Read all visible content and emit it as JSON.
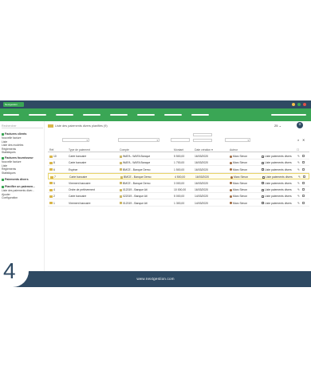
{
  "titlebar": {
    "tag": "Nextgestion"
  },
  "colors": {
    "brand_green": "#3aa655",
    "brand_navy": "#2f4a63",
    "highlight": "#e9d56a"
  },
  "sidebar": {
    "search_placeholder": "Rechercher",
    "sections": [
      {
        "title": "Factures clients",
        "items": [
          "Nouvelle facture",
          "Liste",
          "Liste des modèles",
          "Règlements",
          "Statistiques"
        ]
      },
      {
        "title": "Factures fournisseur",
        "items": [
          "Nouvelle facture",
          "Liste",
          "Règlements",
          "Statistiques"
        ]
      },
      {
        "title": "Paiements divers",
        "items": []
      },
      {
        "title": "Planifier un paiemen...",
        "items": [
          "Liste des paiements diver...",
          "Ajouter",
          "Configuration"
        ]
      }
    ]
  },
  "main": {
    "title": "Liste des paiements divers planifiés",
    "title_count": "(9)",
    "per_page": "25",
    "columns": [
      "Réf.",
      "Type de paiement",
      "Compte",
      "Montant",
      "Date création",
      "Auteur"
    ],
    "rows": [
      {
        "ref": "10",
        "type": "Carte bancaire",
        "account": "WAFA - WAFA Banque",
        "amount": "5 500,00",
        "date": "16/03/2020",
        "author": "Marc Simon",
        "list": "Liste paiements divers",
        "selected": false
      },
      {
        "ref": "8",
        "type": "Carte bancaire",
        "account": "WAFA - WAFA Banque",
        "amount": "1 700,00",
        "date": "16/03/2020",
        "author": "Marc Simon",
        "list": "Liste paiements divers",
        "selected": false
      },
      {
        "ref": "6",
        "type": "Espèce",
        "account": "BMCE - Banque Demo",
        "amount": "1 500,00",
        "date": "16/03/2020",
        "author": "Marc Simon",
        "list": "Liste paiements divers",
        "selected": false
      },
      {
        "ref": "7",
        "type": "Carte bancaire",
        "account": "BMCE - Banque Demo",
        "amount": "4 500,00",
        "date": "16/03/2020",
        "author": "Marc Simon",
        "list": "Liste paiements divers",
        "selected": true
      },
      {
        "ref": "5",
        "type": "Virement bancaire",
        "account": "BMCE - Banque Demo",
        "amount": "3 000,00",
        "date": "16/03/2020",
        "author": "Marc Simon",
        "list": "Liste paiements divers",
        "selected": false
      },
      {
        "ref": "4",
        "type": "Ordre de prélèvement",
        "account": "012019 - Banque Ati",
        "amount": "10 000,00",
        "date": "16/03/2020",
        "author": "Marc Simon",
        "list": "Liste paiements divers",
        "selected": false
      },
      {
        "ref": "2",
        "type": "Carte bancaire",
        "account": "022019 - Banque Ati",
        "amount": "5 000,00",
        "date": "14/03/2020",
        "author": "Marc Simon",
        "list": "Liste paiements divers",
        "selected": false
      },
      {
        "ref": "1",
        "type": "Virement bancaire",
        "account": "012019 - Banque Ati",
        "amount": "1 300,00",
        "date": "14/03/2020",
        "author": "Marc Simon",
        "list": "Liste paiements divers",
        "selected": false
      }
    ]
  },
  "banner": {
    "step": "4",
    "site": "www.nextgestion.com"
  }
}
